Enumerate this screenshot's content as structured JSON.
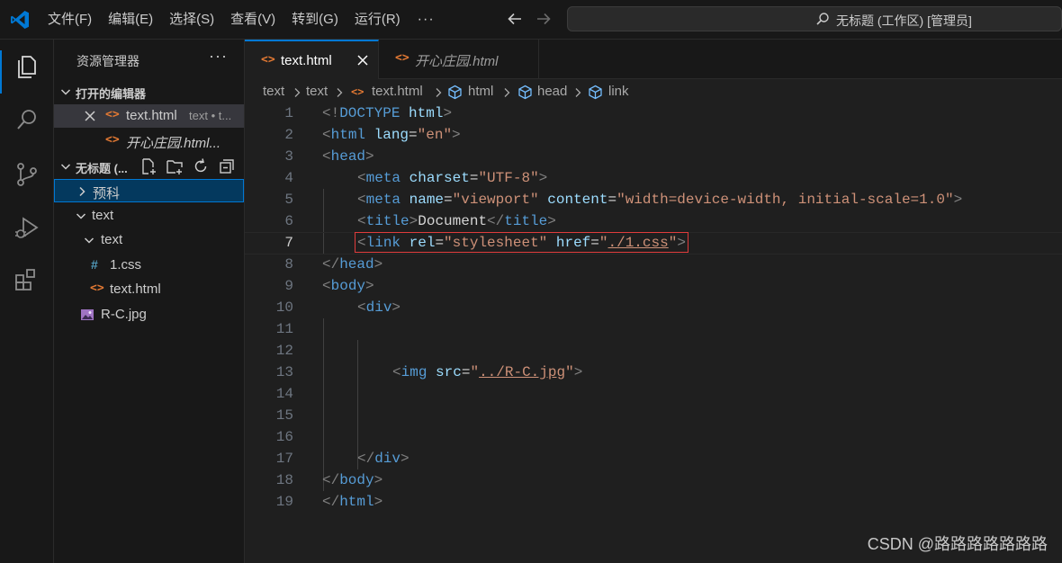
{
  "menu": {
    "file": "文件(F)",
    "edit": "编辑(E)",
    "selection": "选择(S)",
    "view": "查看(V)",
    "go": "转到(G)",
    "run": "运行(R)",
    "more": "···"
  },
  "search": {
    "text": "无标题 (工作区) [管理员]"
  },
  "sidebar": {
    "title": "资源管理器",
    "more": "···",
    "open_editors": {
      "header": "打开的编辑器",
      "items": [
        {
          "label": "text.html",
          "detail": "text • t..."
        },
        {
          "label": "开心庄园.html..."
        }
      ]
    },
    "workspace": {
      "header": "无标题 (...",
      "items": [
        {
          "label": "预科"
        },
        {
          "label": "text"
        },
        {
          "label": "text"
        },
        {
          "label": "1.css",
          "icon": "#"
        },
        {
          "label": "text.html"
        },
        {
          "label": "R-C.jpg"
        }
      ]
    }
  },
  "tabs": [
    {
      "label": "text.html"
    },
    {
      "label": "开心庄园.html"
    }
  ],
  "breadcrumb": [
    "text",
    "text",
    "text.html",
    "html",
    "head",
    "link"
  ],
  "code_lines": [
    "1",
    "2",
    "3",
    "4",
    "5",
    "6",
    "7",
    "8",
    "9",
    "10",
    "11",
    "12",
    "13",
    "14",
    "15",
    "16",
    "17",
    "18",
    "19"
  ],
  "code": {
    "l1": [
      "<!",
      "DOCTYPE",
      " ",
      "html",
      ">"
    ],
    "l2": [
      "<",
      "html",
      " ",
      "lang",
      "=",
      "\"en\"",
      ">"
    ],
    "l3": [
      "<",
      "head",
      ">"
    ],
    "l4": [
      "<",
      "meta",
      " ",
      "charset",
      "=",
      "\"UTF-8\"",
      ">"
    ],
    "l5": [
      "<",
      "meta",
      " ",
      "name",
      "=",
      "\"viewport\"",
      " ",
      "content",
      "=",
      "\"width=device-width, initial-scale=1.0\"",
      ">"
    ],
    "l6": [
      "<",
      "title",
      ">",
      "Document",
      "</",
      "title",
      ">"
    ],
    "l7": [
      "<",
      "link",
      " ",
      "rel",
      "=",
      "\"stylesheet\"",
      " ",
      "href",
      "=",
      "\"",
      "./1.css",
      "\"",
      ">"
    ],
    "l8": [
      "</",
      "head",
      ">"
    ],
    "l9": [
      "<",
      "body",
      ">"
    ],
    "l10": [
      "<",
      "div",
      ">"
    ],
    "l13": [
      "<",
      "img",
      " ",
      "src",
      "=",
      "\"",
      "../R-C.jpg",
      "\"",
      ">"
    ],
    "l17": [
      "</",
      "div",
      ">"
    ],
    "l18": [
      "</",
      "body",
      ">"
    ],
    "l19": [
      "</",
      "html",
      ">"
    ]
  },
  "watermark": "CSDN @路路路路路路路",
  "colors": {
    "accent": "#0078d4",
    "html_icon": "#e37933",
    "css_icon": "#519aba",
    "highlight_box": "#e03c3c"
  }
}
